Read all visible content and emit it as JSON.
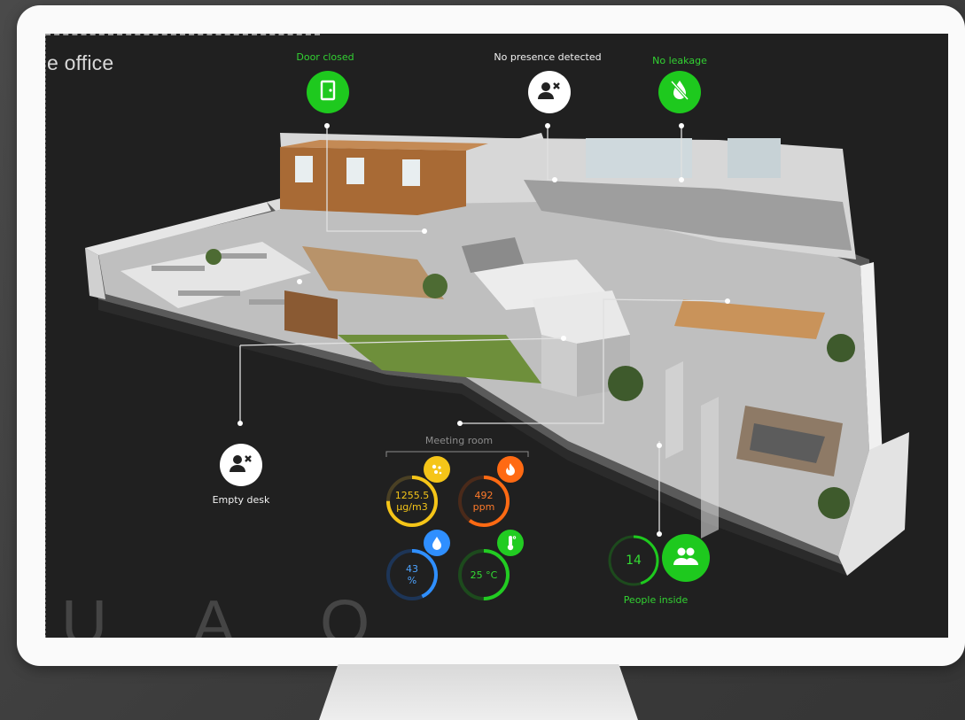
{
  "screen": {
    "title": "e office",
    "watermark": "U A O"
  },
  "sensors": {
    "door": {
      "label": "Door closed",
      "icon": "door-icon",
      "color": "#1ec91e"
    },
    "presence": {
      "label": "No presence detected",
      "icon": "person-off-icon",
      "color": "#ffffff"
    },
    "leak": {
      "label": "No leakage",
      "icon": "water-drop-off-icon",
      "color": "#1ec91e"
    },
    "desk": {
      "label": "Empty desk",
      "icon": "person-off-icon",
      "color": "#ffffff"
    }
  },
  "meeting_room": {
    "title": "Meeting room",
    "particles": {
      "value": "1255.5",
      "unit": "µg/m3",
      "icon": "particles-icon",
      "color": "#f5c518",
      "level": 0.75
    },
    "co2": {
      "value": "492",
      "unit": "ppm",
      "icon": "flame-icon",
      "color": "#ff6a13",
      "level": 0.6
    },
    "humidity": {
      "value": "43",
      "unit": "%",
      "icon": "water-drop-icon",
      "color": "#2f8fff",
      "level": 0.43
    },
    "temperature": {
      "value": "25 °C",
      "icon": "thermometer-icon",
      "color": "#22cc22",
      "level": 0.5
    }
  },
  "occupancy": {
    "count": "14",
    "label": "People inside",
    "icon": "people-icon",
    "color": "#1ec91e",
    "level": 0.45
  }
}
